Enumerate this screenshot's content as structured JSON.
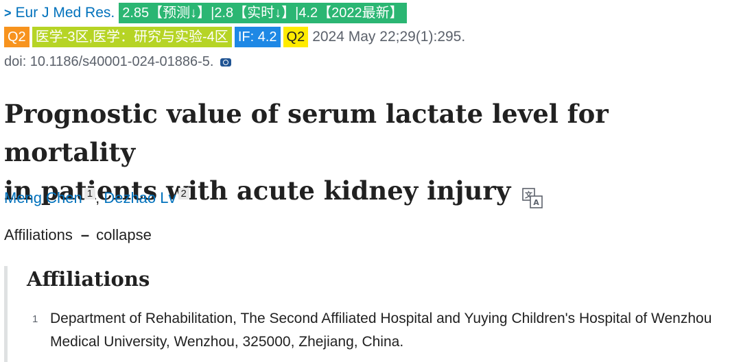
{
  "journal": {
    "name": "Eur J Med Res.",
    "metrics_badge": "2.85【预测↓】|2.8【实时↓】|4.2【2022最新】",
    "quartile_badge": "Q2",
    "category_badge": "医学-3区,医学：研究与实验-4区",
    "if_badge": "IF: 4.2",
    "quartile_badge_2": "Q2",
    "citation": "2024 May 22;29(1):295.",
    "doi": "doi: 10.1186/s40001-024-01886-5."
  },
  "article": {
    "title_line1": "Prognostic value of serum lactate level for mortality",
    "title_line2": "in patients with acute kidney injury"
  },
  "authors": [
    {
      "name": "Meng Chen",
      "sup": "1"
    },
    {
      "name": "Dezhao Lv",
      "sup": "2"
    }
  ],
  "affiliations_toggle": {
    "label": "Affiliations",
    "dash": "–",
    "action": "collapse"
  },
  "affiliations": {
    "heading": "Affiliations",
    "items": [
      {
        "num": "1",
        "text": "Department of Rehabilitation, The Second Affiliated Hospital and Yuying Children's Hospital of Wenzhou Medical University, Wenzhou, 325000, Zhejiang, China."
      }
    ]
  },
  "colors": {
    "link": "#0071bc",
    "badge_green": "#2bb673",
    "badge_orange": "#f7931e",
    "badge_lime": "#b6d425",
    "badge_blue": "#1e88e5",
    "badge_yellow": "#ffeb00"
  },
  "icons": {
    "journal_chevron": "chevron-right-icon",
    "doi_camera": "camera-icon",
    "title_translate": "translate-icon"
  }
}
